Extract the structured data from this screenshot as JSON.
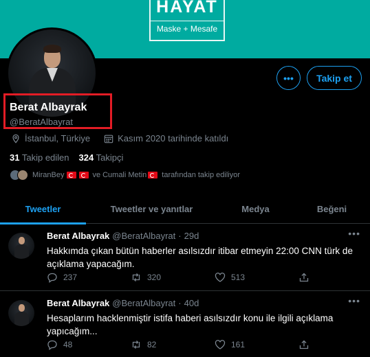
{
  "banner": {
    "title": "HAYAT",
    "subtitle": "Maske + Mesafe"
  },
  "profile": {
    "name": "Berat Albayrak",
    "handle": "@BeratAlbayrat",
    "location": "İstanbul, Türkiye",
    "joined": "Kasım 2020 tarihinde katıldı",
    "following_count": "31",
    "following_label": "Takip edilen",
    "followers_count": "324",
    "followers_label": "Takipçi",
    "followed_by_a": "MiranBey",
    "followed_by_and": "ve",
    "followed_by_b": "Cumali Metin",
    "followed_by_suffix": "tarafından takip ediliyor"
  },
  "buttons": {
    "more": "•••",
    "follow": "Takip et"
  },
  "tabs": [
    {
      "label": "Tweetler",
      "active": true
    },
    {
      "label": "Tweetler ve yanıtlar"
    },
    {
      "label": "Medya"
    },
    {
      "label": "Beğeni"
    }
  ],
  "tweets": [
    {
      "name": "Berat Albayrak",
      "handle": "@BeratAlbayrat",
      "sep": "·",
      "time": "29d",
      "text": "Hakkımda çıkan bütün haberler asılsızdır itibar etmeyin 22:00 CNN türk de açıklama yapacağım.",
      "replies": "237",
      "retweets": "320",
      "likes": "513"
    },
    {
      "name": "Berat Albayrak",
      "handle": "@BeratAlbayrat",
      "sep": "·",
      "time": "40d",
      "text": "Hesaplarım hacklenmiştir istifa haberi asılsızdır konu ile ilgili açıklama yapıcağım...",
      "replies": "48",
      "retweets": "82",
      "likes": "161"
    }
  ],
  "colors": {
    "accent": "#1da1f2",
    "banner": "#00aba0",
    "highlight": "#e31c25",
    "background": "#000000"
  }
}
